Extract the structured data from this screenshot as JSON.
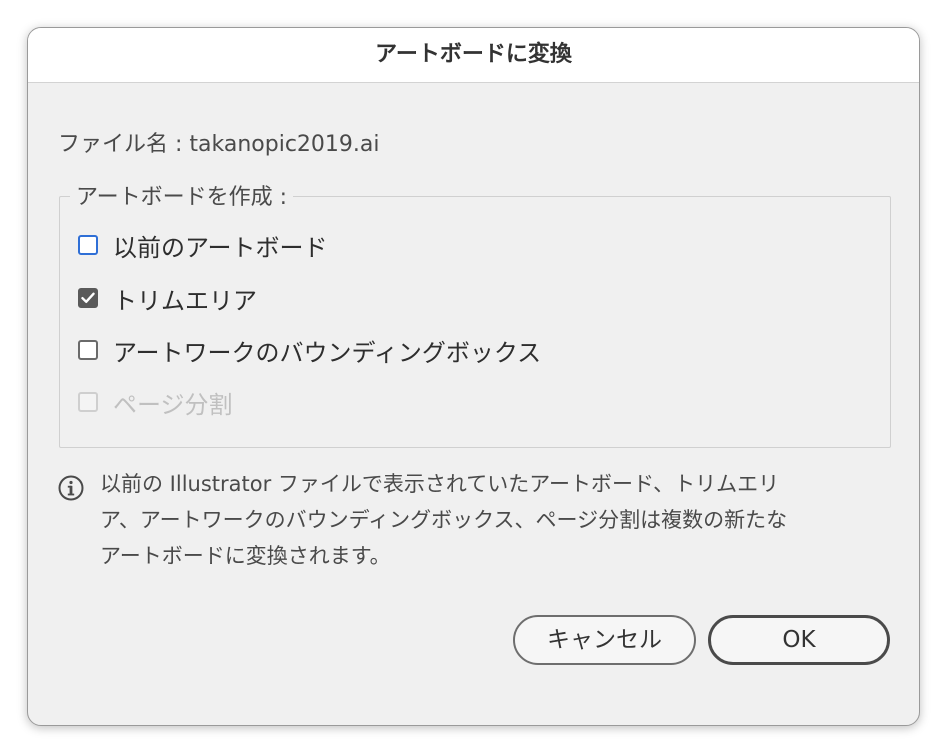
{
  "dialog": {
    "title": "アートボードに変換",
    "filename_label": "ファイル名 : takanopic2019.ai",
    "group_title": "アートボードを作成 :",
    "options": [
      {
        "label": "以前のアートボード",
        "checked": false,
        "enabled": true,
        "focused": true
      },
      {
        "label": "トリムエリア",
        "checked": true,
        "enabled": true,
        "focused": false
      },
      {
        "label": "アートワークのバウンディングボックス",
        "checked": false,
        "enabled": true,
        "focused": false
      },
      {
        "label": "ページ分割",
        "checked": false,
        "enabled": false,
        "focused": false
      }
    ],
    "info_icon": "info-circle-icon",
    "info_lines": [
      "以前の Illustrator ファイルで表示されていたアートボード、トリムエリ",
      "ア、アートワークのバウンディングボックス、ページ分割は複数の新たな",
      "アートボードに変換されます。"
    ],
    "cancel_label": "キャンセル",
    "ok_label": "OK"
  },
  "colors": {
    "dialog_bg": "#f0f0f0",
    "titlebar_bg": "#ffffff",
    "focus_ring": "#2f6fd6",
    "checked_fill": "#5a5a5a",
    "disabled_text": "#c0c0c0"
  }
}
